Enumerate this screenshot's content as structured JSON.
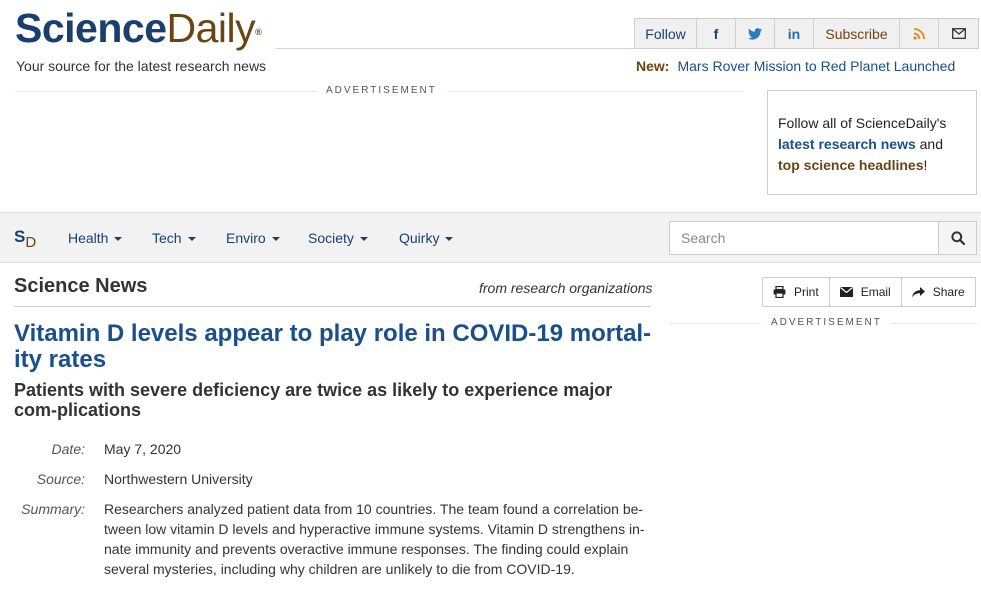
{
  "header": {
    "logo_science": "Science",
    "logo_daily": "Daily",
    "logo_reg": "®",
    "tagline": "Your source for the latest research news",
    "new_label": "New:",
    "new_headline": "Mars Rover Mission to Red Planet Launched"
  },
  "social": {
    "follow_label": "Follow",
    "subscribe_label": "Subscribe",
    "icons": [
      "facebook-icon",
      "twitter-icon",
      "linkedin-icon",
      "rss-icon",
      "email-icon"
    ]
  },
  "ads": {
    "label_top": "ADVERTISEMENT",
    "label_side": "ADVERTISEMENT"
  },
  "follow_box": {
    "line1": "Follow all of ScienceDaily's",
    "link1": "latest research news",
    "mid": " and",
    "link2": "top science headlines",
    "end": "!"
  },
  "nav": {
    "mark_s": "S",
    "mark_d": "D",
    "items": [
      "Health",
      "Tech",
      "Enviro",
      "Society",
      "Quirky"
    ],
    "search_placeholder": "Search"
  },
  "section": {
    "title": "Science News",
    "from": "from research organizations"
  },
  "tools": {
    "print": "Print",
    "email": "Email",
    "share": "Share"
  },
  "article": {
    "title": "Vitamin D levels appear to play role in COVID-19 mortal-ity rates",
    "subtitle": "Patients with severe deficiency are twice as likely to experience major com-plications",
    "date_label": "Date:",
    "date": "May 7, 2020",
    "source_label": "Source:",
    "source": "Northwestern University",
    "summary_label": "Summary:",
    "summary": "Researchers analyzed patient data from 10 countries. The team found a correlation be-tween low vitamin D levels and hyperactive immune systems. Vitamin D strengthens in-nate immunity and prevents overactive immune responses. The finding could explain several mysteries, including why children are unlikely to die from COVID-19."
  },
  "colors": {
    "brand_blue": "#1a3f6e",
    "brand_brown": "#6b4413",
    "link_blue": "#1a4f8b"
  }
}
